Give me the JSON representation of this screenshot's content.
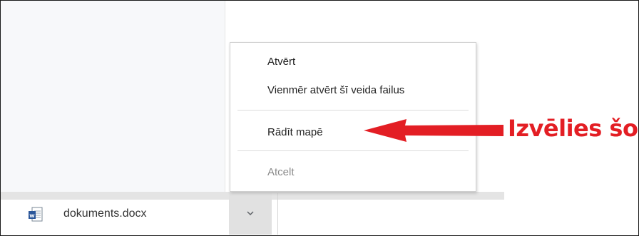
{
  "context_menu": {
    "items": [
      {
        "label": "Atvērt",
        "enabled": true
      },
      {
        "label": "Vienmēr atvērt šī veida failus",
        "enabled": true
      },
      {
        "label": "Rādīt mapē",
        "enabled": true
      },
      {
        "label": "Atcelt",
        "enabled": false
      }
    ]
  },
  "download_shelf": {
    "file_name": "dokuments.docx",
    "file_icon": "word-document-icon",
    "menu_button_icon": "chevron-down-icon"
  },
  "annotation": {
    "callout_text": "Izvēlies šo",
    "color": "#e31e24"
  }
}
